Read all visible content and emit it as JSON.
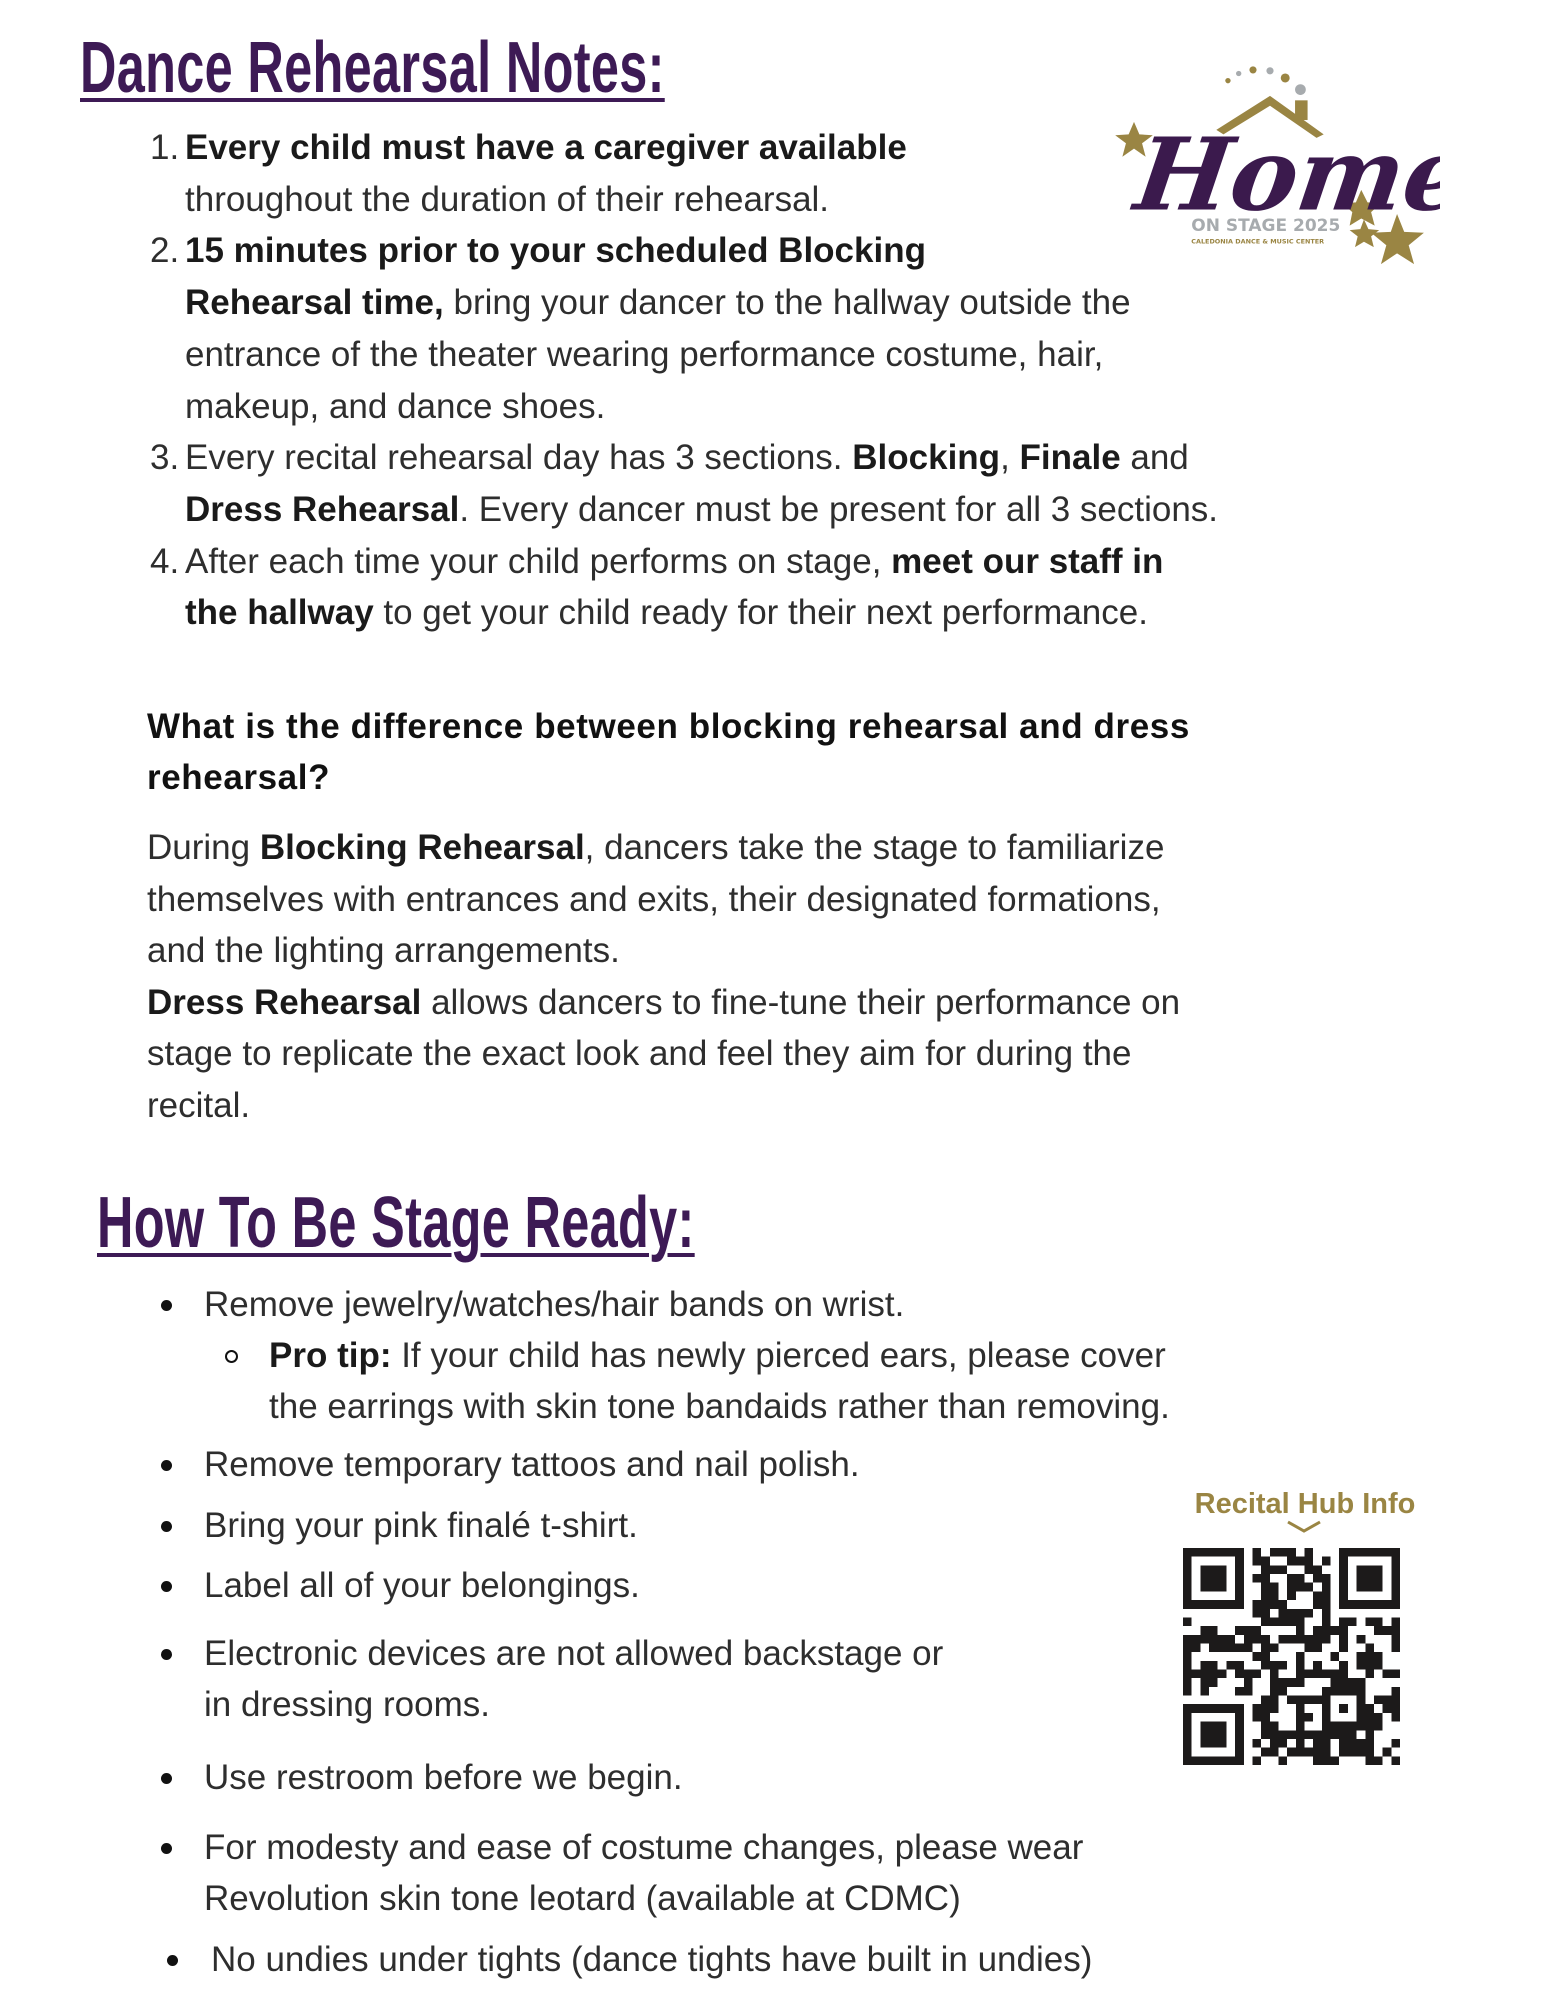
{
  "notes": {
    "title": "Dance Rehearsal Notes:",
    "items": [
      {
        "number": "1.",
        "lines": [
          [
            {
              "text": "Every child must have a caregiver available",
              "bold": true
            }
          ],
          [
            {
              "text": "throughout the duration of their rehearsal.",
              "bold": false
            }
          ]
        ]
      },
      {
        "number": "2.",
        "lines": [
          [
            {
              "text": "15 minutes prior to your scheduled Blocking",
              "bold": true
            }
          ],
          [
            {
              "text": "Rehearsal time,",
              "bold": true
            },
            {
              "text": " bring your dancer to the hallway outside the",
              "bold": false
            }
          ],
          [
            {
              "text": "entrance of the theater wearing performance costume, hair,",
              "bold": false
            }
          ],
          [
            {
              "text": "makeup, and dance shoes.",
              "bold": false
            }
          ]
        ]
      },
      {
        "number": "3.",
        "lines": [
          [
            {
              "text": "Every recital rehearsal day has 3 sections. ",
              "bold": false
            },
            {
              "text": "Blocking",
              "bold": true
            },
            {
              "text": ", ",
              "bold": false
            },
            {
              "text": "Finale",
              "bold": true
            },
            {
              "text": " and",
              "bold": false
            }
          ],
          [
            {
              "text": "Dress Rehearsal",
              "bold": true
            },
            {
              "text": ". Every dancer must be present for all 3 sections.",
              "bold": false
            }
          ]
        ]
      },
      {
        "number": "4.",
        "lines": [
          [
            {
              "text": "After each time your child performs on stage, ",
              "bold": false
            },
            {
              "text": "meet our staff in",
              "bold": true
            }
          ],
          [
            {
              "text": "the hallway",
              "bold": true
            },
            {
              "text": " to get your child ready for their next performance.",
              "bold": false
            }
          ]
        ]
      }
    ]
  },
  "faq": {
    "question_lines": [
      "What is the difference between blocking rehearsal and dress",
      "rehearsal?"
    ],
    "answer_lines": [
      [
        {
          "text": "During ",
          "bold": false
        },
        {
          "text": "Blocking Rehearsal",
          "bold": true
        },
        {
          "text": ", dancers take the stage to familiarize",
          "bold": false
        }
      ],
      [
        {
          "text": "themselves with entrances and exits, their designated formations,",
          "bold": false
        }
      ],
      [
        {
          "text": "and the lighting arrangements.",
          "bold": false
        }
      ],
      [
        {
          "text": "Dress Rehearsal",
          "bold": true
        },
        {
          "text": " allows dancers to fine-tune their performance on",
          "bold": false
        }
      ],
      [
        {
          "text": "stage to replicate the exact look and feel they aim for during the",
          "bold": false
        }
      ],
      [
        {
          "text": "recital.",
          "bold": false
        }
      ]
    ]
  },
  "stage_ready": {
    "title": "How To Be Stage Ready:",
    "bullets": [
      {
        "lines": [
          [
            {
              "text": "Remove jewelry/watches/hair bands on wrist.",
              "bold": false
            }
          ]
        ],
        "sub": [
          [
            {
              "text": "Pro tip:",
              "bold": true
            },
            {
              "text": " If your child has newly pierced ears, please cover",
              "bold": false
            }
          ],
          [
            {
              "text": "the earrings with skin tone bandaids rather than removing.",
              "bold": false
            }
          ]
        ]
      },
      {
        "lines": [
          [
            {
              "text": "Remove temporary tattoos and nail polish.",
              "bold": false
            }
          ]
        ]
      },
      {
        "lines": [
          [
            {
              "text": "Bring your pink finalé t-shirt.",
              "bold": false
            }
          ]
        ]
      },
      {
        "lines": [
          [
            {
              "text": "Label all of your belongings.",
              "bold": false
            }
          ]
        ]
      },
      {
        "lines": [
          [
            {
              "text": "Electronic devices are not allowed backstage or",
              "bold": false
            }
          ],
          [
            {
              "text": "in dressing rooms.",
              "bold": false
            }
          ]
        ]
      },
      {
        "lines": [
          [
            {
              "text": "Use restroom before we begin.",
              "bold": false
            }
          ]
        ]
      },
      {
        "lines": [
          [
            {
              "text": "For modesty and ease of costume changes, please wear",
              "bold": false
            }
          ],
          [
            {
              "text": "Revolution skin tone leotard (available at CDMC)",
              "bold": false
            }
          ]
        ]
      },
      {
        "lines": [
          [
            {
              "text": "No undies under tights (dance tights have built in undies)",
              "bold": false
            }
          ]
        ]
      }
    ]
  },
  "logo": {
    "script_text": "Home",
    "tagline": "ON STAGE 2025",
    "organization": "CALEDONIA DANCE & MUSIC CENTER"
  },
  "qr": {
    "label": "Recital Hub Info",
    "icon": "chevron-down-icon"
  },
  "colors": {
    "heading_purple": "#3d1a55",
    "gold": "#9a8543",
    "gray": "#a7abae",
    "text": "#2e2e2e"
  }
}
